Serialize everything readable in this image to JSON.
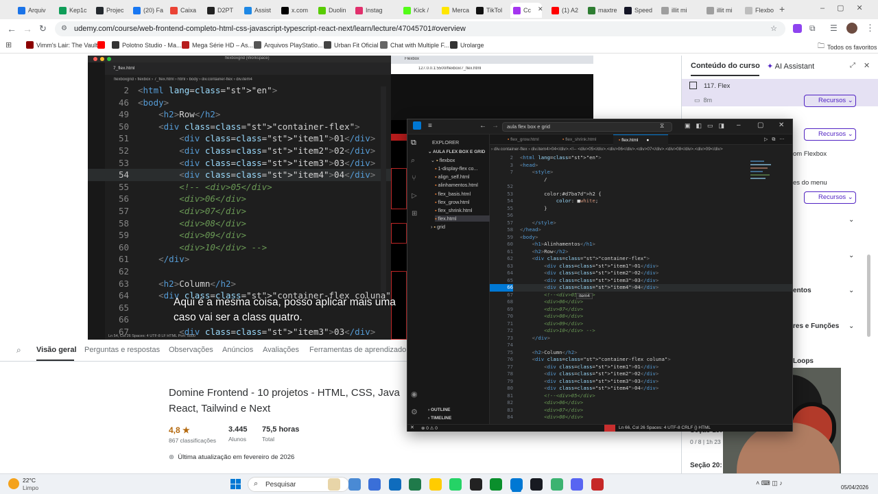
{
  "browser": {
    "tabs": [
      {
        "label": "Arquiv",
        "color": "#1a73e8"
      },
      {
        "label": "Kep1c",
        "color": "#0f9d58"
      },
      {
        "label": "Projec",
        "color": "#24292e"
      },
      {
        "label": "(20) Fa",
        "color": "#1877f2"
      },
      {
        "label": "Caixa",
        "color": "#ea4335"
      },
      {
        "label": "D2PT",
        "color": "#222222"
      },
      {
        "label": "Assist",
        "color": "#1e88e5"
      },
      {
        "label": "x.com",
        "color": "#000000"
      },
      {
        "label": "Duolin",
        "color": "#58cc02"
      },
      {
        "label": "Instag",
        "color": "#e1306c"
      },
      {
        "label": "Kick /",
        "color": "#53fc18"
      },
      {
        "label": "Merca",
        "color": "#ffe600"
      },
      {
        "label": "TikTol",
        "color": "#111111"
      },
      {
        "label": "Cc",
        "color": "#a435f0"
      },
      {
        "label": "(1) A2",
        "color": "#ff0000"
      },
      {
        "label": "maxtre",
        "color": "#2e7d32"
      },
      {
        "label": "Speed",
        "color": "#141526"
      },
      {
        "label": "illit mi",
        "color": "#9e9e9e"
      },
      {
        "label": "illit mi",
        "color": "#9e9e9e"
      },
      {
        "label": "Flexbo",
        "color": "#bdbdbd"
      }
    ],
    "url": "udemy.com/course/web-frontend-completo-html-css-javascript-typescript-react-next/learn/lecture/47045701#overview",
    "bookmarks": [
      {
        "label": "Vimm's Lair: The Vault",
        "color": "#8b0000"
      },
      {
        "label": "",
        "color": "#ff0000"
      },
      {
        "label": "Polotno Studio - Ma...",
        "color": "#333333"
      },
      {
        "label": "Mega Série HD – As...",
        "color": "#b71c1c"
      },
      {
        "label": "Arquivos PlayStatio...",
        "color": "#555555"
      },
      {
        "label": "Urban Fit Oficial",
        "color": "#444444"
      },
      {
        "label": "Chat with Multiple F...",
        "color": "#666666"
      },
      {
        "label": "Urolarge",
        "color": "#333333"
      }
    ],
    "bookmarks_all": "Todos os favoritos"
  },
  "video": {
    "breadcrumb": "flexboxgrid › flexbox › 7_flex.html › html › body › div.container-flex › div.item4",
    "file_tab": "7_flex.html",
    "workspace": "flexboxgrid (Workspace)",
    "lines": [
      {
        "n": "2",
        "t": "<html lang=\"en\">"
      },
      {
        "n": "46",
        "t": "<body>"
      },
      {
        "n": "49",
        "t": "    <h2>Row</h2>"
      },
      {
        "n": "50",
        "t": "    <div class=\"container-flex\">"
      },
      {
        "n": "51",
        "t": "        <div class=\"item1\">01</div>"
      },
      {
        "n": "52",
        "t": "        <div class=\"item2\">02</div>"
      },
      {
        "n": "53",
        "t": "        <div class=\"item3\">03</div>"
      },
      {
        "n": "54",
        "t": "        <div class=\"item4\">04</div>"
      },
      {
        "n": "55",
        "t": "        <!-- <div>05</div>"
      },
      {
        "n": "56",
        "t": "        <div>06</div>"
      },
      {
        "n": "57",
        "t": "        <div>07</div>"
      },
      {
        "n": "58",
        "t": "        <div>08</div>"
      },
      {
        "n": "59",
        "t": "        <div>09</div>"
      },
      {
        "n": "60",
        "t": "        <div>10</div> -->"
      },
      {
        "n": "61",
        "t": "    </div>"
      },
      {
        "n": "62",
        "t": ""
      },
      {
        "n": "63",
        "t": "    <h2>Column</h2>"
      },
      {
        "n": "64",
        "t": "    <div class=\"container-flex coluna\">"
      },
      {
        "n": "65",
        "t": ""
      },
      {
        "n": "66",
        "t": ""
      },
      {
        "n": "67",
        "t": "        <div class=\"item3\">03</div>"
      }
    ],
    "caption_1": "Aqui é a mesma coisa, posso aplicar mais uma",
    "caption_2": "caso vai ser a class quatro.",
    "status": "Ln 54, Col 26   Spaces: 4   UTF-8   LF   HTML   Port: 5500",
    "preview_url": "127.0.0.1:5500/flexbox/7_flex.html",
    "preview_tab": "Flexbox"
  },
  "udemy": {
    "tabs": [
      "Visão geral",
      "Perguntas e respostas",
      "Observações",
      "Anúncios",
      "Avaliações",
      "Ferramentas de aprendizado"
    ],
    "course_title_1": "Domine Frontend - 10 projetos - HTML, CSS, Java",
    "course_title_2": "React, Tailwind e Next",
    "rating": "4,8 ★",
    "ratings_count": "867 classificações",
    "students": "3.445",
    "students_label": "Alunos",
    "hours": "75,5 horas",
    "hours_label": "Total",
    "updated": "Última atualização em fevereiro de 2026"
  },
  "sidebar": {
    "tab_content": "Conteúdo do curso",
    "tab_ai": "AI Assistant",
    "lesson": "117. Flex",
    "lesson_time": "8m",
    "resources": "Recursos",
    "snippet_flexbox": "om Flexbox",
    "snippet_menu": "es do menu",
    "snippet_entos": "entos",
    "snippet_funcoes": "res e Funções",
    "snippet_loops": "Loops",
    "section19": "Seção 19:",
    "section19_progress": "0 / 8 | 1h 23",
    "section20": "Seção 20:"
  },
  "vscode": {
    "search": "aula flex box e grid",
    "explorer_title": "EXPLORER",
    "workspace": "AULA FLEX BOX E GRID",
    "folder_flexbox": "flexbox",
    "files": [
      "1-display-flex co...",
      "align_self.html",
      "alinhamentos.html",
      "flex_basis.html",
      "flex_grow.html",
      "flex_shrink.html",
      "flex.html"
    ],
    "folder_grid": "grid",
    "outline": "OUTLINE",
    "timeline": "TIMELINE",
    "tabs": [
      "flex_grow.html",
      "flex_shrink.html",
      "flex.html"
    ],
    "breadcrumb": "› div.container-flex › div.item4>04</div>.<!-- <div>05</div>.<div>06</div>.<div>07</div>.<div>08</div>.<div>09</div>",
    "tooltip": "item4",
    "status": "Ln 66, Col 26   Spaces: 4   UTF-8   CRLF   {} HTML",
    "errors": "⊗ 0 ⚠ 0",
    "lines": [
      {
        "n": "2",
        "t": "<html lang=\"en\">"
      },
      {
        "n": "3",
        "t": "<head>"
      },
      {
        "n": "7",
        "t": "    <style>"
      },
      {
        "n": "",
        "t": "        /"
      },
      {
        "n": "52",
        "t": ""
      },
      {
        "n": "53",
        "t": "        h2 {"
      },
      {
        "n": "54",
        "t": "            color: ■white;"
      },
      {
        "n": "55",
        "t": "        }"
      },
      {
        "n": "56",
        "t": ""
      },
      {
        "n": "57",
        "t": "    </style>"
      },
      {
        "n": "58",
        "t": "</head>"
      },
      {
        "n": "59",
        "t": "<body>"
      },
      {
        "n": "60",
        "t": "    <h1>Alinhamentos</h1>"
      },
      {
        "n": "61",
        "t": "    <h2>Row</h2>"
      },
      {
        "n": "62",
        "t": "    <div class=\"container-flex\">"
      },
      {
        "n": "63",
        "t": "        <div class=\"item1\">01</div>"
      },
      {
        "n": "64",
        "t": "        <div class=\"item2\">02</div>"
      },
      {
        "n": "65",
        "t": "        <div class=\"item3\">03</div>"
      },
      {
        "n": "66",
        "t": "        <div class=\"item4\">04</div>"
      },
      {
        "n": "67",
        "t": "        <!--<div>05</div>"
      },
      {
        "n": "68",
        "t": "        <div>06</div>"
      },
      {
        "n": "69",
        "t": "        <div>07</div>"
      },
      {
        "n": "70",
        "t": "        <div>08</div>"
      },
      {
        "n": "71",
        "t": "        <div>09</div>"
      },
      {
        "n": "72",
        "t": "        <div>10</div> -->"
      },
      {
        "n": "73",
        "t": "    </div>"
      },
      {
        "n": "74",
        "t": ""
      },
      {
        "n": "75",
        "t": "    <h2>Column</h2>"
      },
      {
        "n": "76",
        "t": "    <div class=\"container-flex coluna\">"
      },
      {
        "n": "77",
        "t": "        <div class=\"item1\">01</div>"
      },
      {
        "n": "78",
        "t": "        <div class=\"item2\">02</div>"
      },
      {
        "n": "79",
        "t": "        <div class=\"item3\">03</div>"
      },
      {
        "n": "80",
        "t": "        <div class=\"item4\">04</div>"
      },
      {
        "n": "81",
        "t": "        <!--<div>05</div>"
      },
      {
        "n": "82",
        "t": "        <div>06</div>"
      },
      {
        "n": "83",
        "t": "        <div>07</div>"
      },
      {
        "n": "84",
        "t": "        <div>08</div>"
      }
    ]
  },
  "taskbar": {
    "temp": "22°C",
    "weather": "Limpo",
    "search": "Pesquisar",
    "date": "05/04/2026"
  }
}
